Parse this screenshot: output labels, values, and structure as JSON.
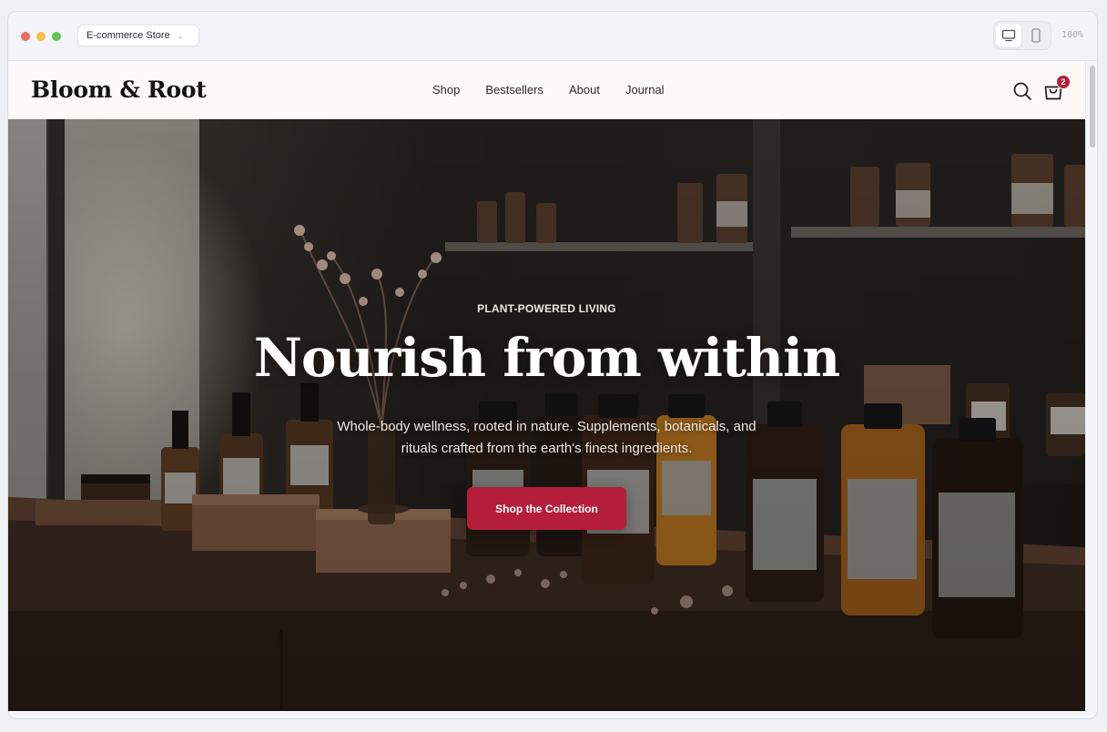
{
  "browser": {
    "tab_title": "E-commerce Store",
    "zoom_label": "100%",
    "traffic_colors": [
      "#ed6a5e",
      "#f4bf4f",
      "#61c554"
    ],
    "active_device": "desktop"
  },
  "header": {
    "logo": "Bloom & Root",
    "nav": [
      "Shop",
      "Bestsellers",
      "About",
      "Journal"
    ],
    "cart_count": "2",
    "icons": [
      "search-icon",
      "cart-icon"
    ]
  },
  "hero": {
    "eyebrow": "PLANT-POWERED LIVING",
    "headline": "Nourish from within",
    "subcopy": "Whole-body wellness, rooted in nature. Supplements, botanicals, and rituals crafted from the earth's finest ingredients.",
    "cta": "Shop the Collection"
  },
  "colors": {
    "accent": "#b51e3a",
    "header_bg": "#fbfaf9"
  }
}
